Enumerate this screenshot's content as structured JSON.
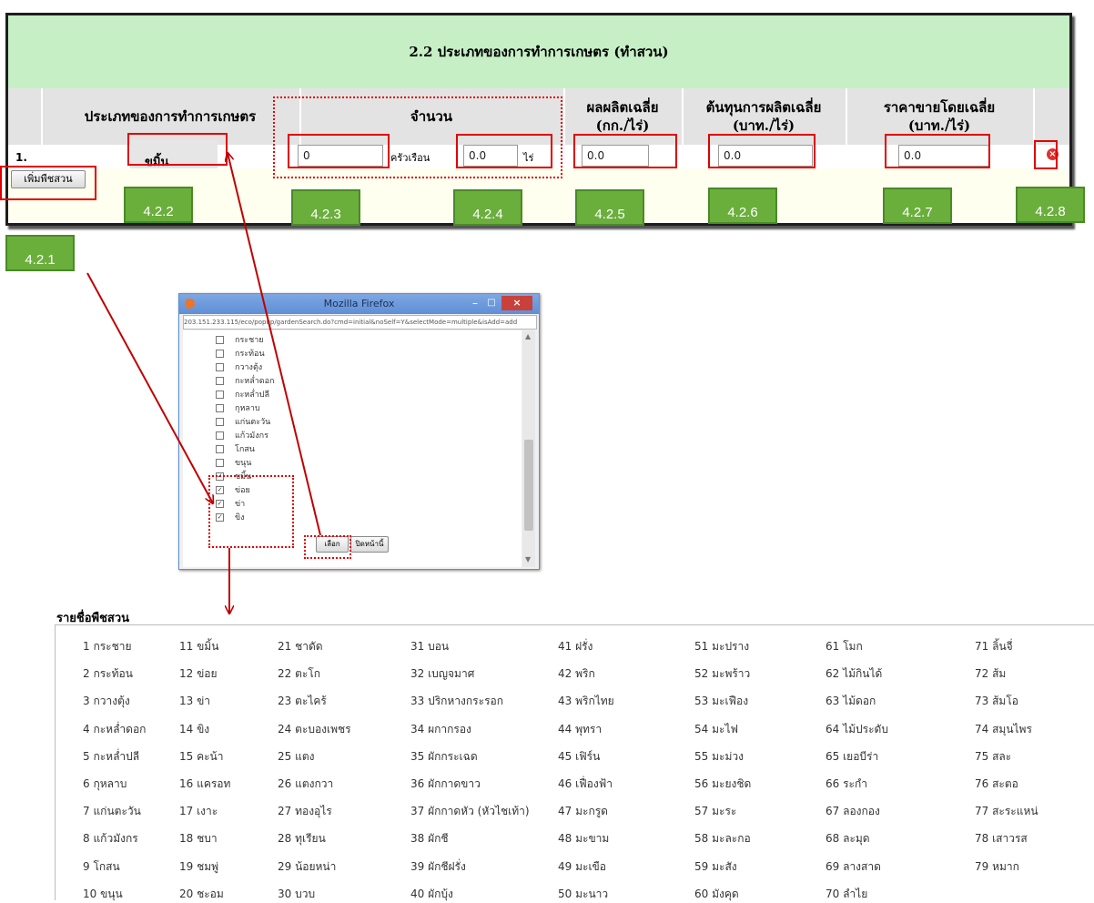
{
  "form": {
    "title": "2.2 ประเภทของการทำการเกษตร (ทำสวน)",
    "headers": {
      "type": "ประเภทของการทำการเกษตร",
      "amount": "จำนวน",
      "yield_l1": "ผลผลิตเฉลี่ย",
      "yield_l2": "(กก./ไร่)",
      "cost_l1": "ต้นทุนการผลิตเฉลี่ย",
      "cost_l2": "(บาท./ไร่)",
      "price_l1": "ราคาขายโดยเฉลี่ย",
      "price_l2": "(บาท./ไร่)"
    },
    "row": {
      "index": "1.",
      "plant": "ขมิ้น",
      "households": "0",
      "households_unit": "ครัวเรือน",
      "area": "0.0",
      "area_unit": "ไร่",
      "yield": "0.0",
      "cost": "0.0",
      "price": "0.0"
    },
    "add_button": "เพิ่มพืชสวน"
  },
  "badges": [
    "4.2.1",
    "4.2.2",
    "4.2.3",
    "4.2.4",
    "4.2.5",
    "4.2.6",
    "4.2.7",
    "4.2.8"
  ],
  "colors": {
    "header_green": "#c6efc6",
    "annotation_red": "#e00000",
    "badge_green": "#6aae3c"
  },
  "popup": {
    "title": "Mozilla Firefox",
    "url": "203.151.233.115/eco/popup/gardenSearch.do?cmd=initial&noSelf=Y&selectMode=multiple&isAdd=add",
    "items": [
      {
        "label": "กระชาย",
        "checked": false
      },
      {
        "label": "กระท้อน",
        "checked": false
      },
      {
        "label": "กวางตุ้ง",
        "checked": false
      },
      {
        "label": "กะหล่ำดอก",
        "checked": false
      },
      {
        "label": "กะหล่ำปลี",
        "checked": false
      },
      {
        "label": "กุหลาบ",
        "checked": false
      },
      {
        "label": "แก่นตะวัน",
        "checked": false
      },
      {
        "label": "แก้วมังกร",
        "checked": false
      },
      {
        "label": "โกสน",
        "checked": false
      },
      {
        "label": "ขนุน",
        "checked": false
      },
      {
        "label": "ขมิ้น",
        "checked": true
      },
      {
        "label": "ข่อย",
        "checked": true
      },
      {
        "label": "ข่า",
        "checked": true
      },
      {
        "label": "ขิง",
        "checked": true
      }
    ],
    "select_button": "เลือก",
    "close_button": "ปิดหน้านี้"
  },
  "plant_list": {
    "title": "รายชื่อพืชสวน",
    "columns": [
      [
        "1 กระชาย",
        "2 กระท้อน",
        "3 กวางตุ้ง",
        "4 กะหล่ำดอก",
        "5 กะหล่ำปลี",
        "6 กุหลาบ",
        "7 แก่นตะวัน",
        "8 แก้วมังกร",
        "9 โกสน",
        "10 ขนุน"
      ],
      [
        "11 ขมิ้น",
        "12 ข่อย",
        "13 ข่า",
        "14 ขิง",
        "15 คะน้า",
        "16 แครอท",
        "17 เงาะ",
        "18 ชบา",
        "19 ชมพู่",
        "20 ชะอม"
      ],
      [
        "21 ชาดัด",
        "22 ตะโก",
        "23 ตะไคร้",
        "24 ตะบองเพชร",
        "25 แตง",
        "26 แตงกวา",
        "27 ทองอุไร",
        "28 ทุเรียน",
        "29 น้อยหน่า",
        "30 บวบ"
      ],
      [
        "31 บอน",
        "32 เบญจมาศ",
        "33 ปริกหางกระรอก",
        "34 ผกากรอง",
        "35 ผักกระเฉด",
        "36 ผักกาดขาว",
        "37 ผักกาดหัว (หัวไชเท้า)",
        "38 ผักชี",
        "39 ผักชีฝรั่ง",
        "40 ผักบุ้ง"
      ],
      [
        "41 ฝรั่ง",
        "42 พริก",
        "43 พริกไทย",
        "44 พุทรา",
        "45 เฟิร์น",
        "46 เฟื่องฟ้า",
        "47 มะกรูด",
        "48 มะขาม",
        "49 มะเขือ",
        "50 มะนาว"
      ],
      [
        "51 มะปราง",
        "52 มะพร้าว",
        "53 มะเฟือง",
        "54 มะไฟ",
        "55 มะม่วง",
        "56 มะยงชิด",
        "57 มะระ",
        "58 มะละกอ",
        "59 มะสัง",
        "60 มังคุด"
      ],
      [
        "61 โมก",
        "62 ไม้กินได้",
        "63 ไม้ดอก",
        "64 ไม้ประดับ",
        "65 เยอบีร่า",
        "66 ระกำ",
        "67 ลองกอง",
        "68 ละมุด",
        "69 ลางสาด",
        "70 ลำไย"
      ],
      [
        "71 ลิ้นจี่",
        "72 ส้ม",
        "73 ส้มโอ",
        "74 สมุนไพร",
        "75 สละ",
        "76 สะตอ",
        "77 สะระแหน่",
        "78 เสาวรส",
        "79 หมาก"
      ]
    ]
  }
}
